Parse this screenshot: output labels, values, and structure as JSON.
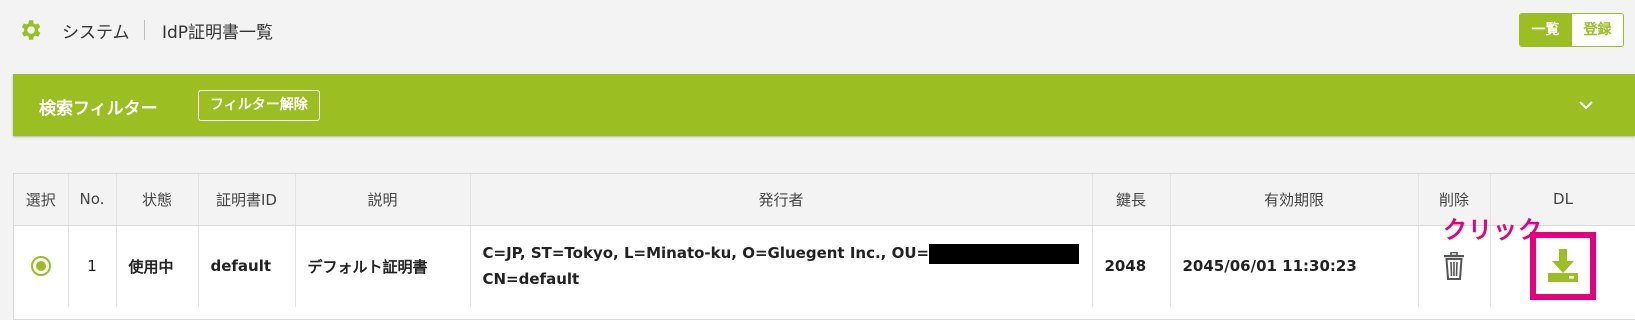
{
  "header": {
    "crumb_system": "システム",
    "crumb_page": "IdP証明書一覧",
    "buttons": {
      "list": "一覧",
      "register": "登録"
    }
  },
  "filter": {
    "title": "検索フィルター",
    "clear_label": "フィルター解除"
  },
  "table": {
    "columns": [
      "選択",
      "No.",
      "状態",
      "証明書ID",
      "説明",
      "発行者",
      "鍵長",
      "有効期限",
      "削除",
      "DL"
    ],
    "rows": [
      {
        "selected": true,
        "no": "1",
        "status": "使用中",
        "cert_id": "default",
        "description": "デフォルト証明書",
        "issuer_line1": "C=JP, ST=Tokyo, L=Minato-ku, O=Gluegent Inc., OU=",
        "issuer_line2": "CN=default",
        "key_length": "2048",
        "expires": "2045/06/01 11:30:23"
      }
    ]
  },
  "annotation": {
    "text": "クリック",
    "color": "#e6007e"
  },
  "colors": {
    "accent": "#9bbf22",
    "highlight": "#e6007e"
  },
  "icons": [
    "gear-icon",
    "chevron-down-icon",
    "radio-selected-icon",
    "trash-icon",
    "download-icon"
  ]
}
